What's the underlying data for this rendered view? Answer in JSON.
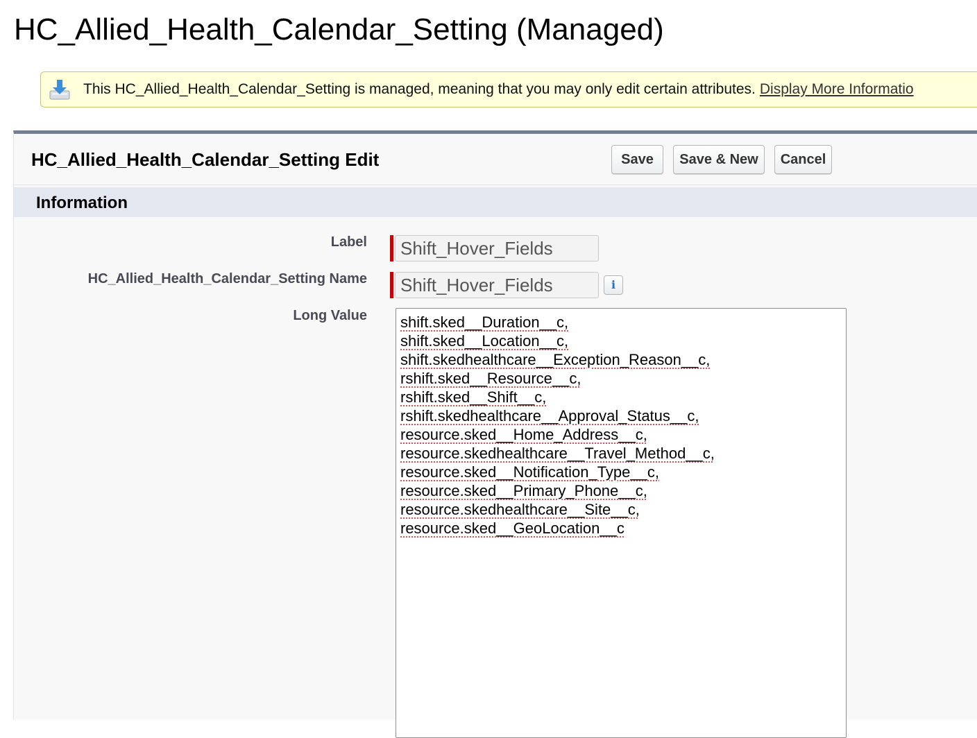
{
  "page": {
    "title": "HC_Allied_Health_Calendar_Setting (Managed)"
  },
  "notice": {
    "icon": "download-tray-icon",
    "text": "This HC_Allied_Health_Calendar_Setting is managed, meaning that you may only edit certain attributes.",
    "link": "Display More Informatio"
  },
  "edit_panel": {
    "title": "HC_Allied_Health_Calendar_Setting Edit",
    "buttons": {
      "save": "Save",
      "save_new": "Save & New",
      "cancel": "Cancel"
    }
  },
  "section": {
    "title": "Information"
  },
  "fields": {
    "label": {
      "label": "Label",
      "value": "Shift_Hover_Fields",
      "required": true
    },
    "name": {
      "label": "HC_Allied_Health_Calendar_Setting Name",
      "value": "Shift_Hover_Fields",
      "required": true,
      "help_icon": "info-icon"
    },
    "long_value": {
      "label": "Long Value",
      "lines": [
        "shift.sked__Duration__c,",
        "shift.sked__Location__c,",
        "shift.skedhealthcare__Exception_Reason__c,",
        "rshift.sked__Resource__c,",
        "rshift.sked__Shift__c,",
        "rshift.skedhealthcare__Approval_Status__c,",
        "resource.sked__Home_Address__c,",
        "resource.skedhealthcare__Travel_Method__c,",
        "resource.sked__Notification_Type__c,",
        "resource.sked__Primary_Phone__c,",
        "resource.skedhealthcare__Site__c,",
        "resource.sked__GeoLocation__c"
      ]
    }
  },
  "colors": {
    "notice_bg": "#ffffdc",
    "required_bar": "#cc0000",
    "panel_top_border": "#747e96",
    "section_bg": "#e3e7ef",
    "spellcheck_underline": "#e05050"
  }
}
